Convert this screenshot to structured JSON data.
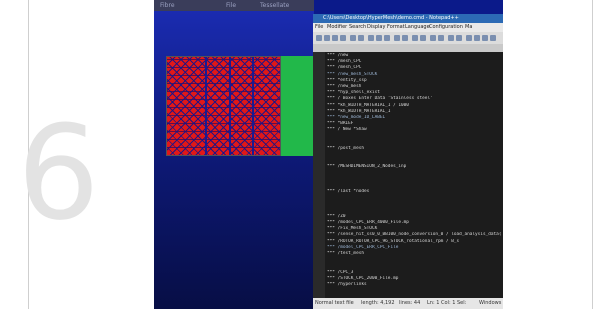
{
  "background_digit": "6",
  "viewer": {
    "menu": [
      "Fibre",
      "File",
      "Tessellate"
    ]
  },
  "editor": {
    "title": "C:\\Users\\Desktop\\HyperMesh\\demo.cmd - Notepad++",
    "menu": [
      "File",
      "Modifier",
      "Search",
      "Display",
      "Format",
      "Language",
      "Configuration",
      "Ma"
    ],
    "lines": [
      "*** /new",
      "*** /mesh_CPC",
      "*** /mesh_CPC",
      "*** /new_mesh_STOCK",
      "*** *entity_ssp",
      "*** /new_mesh",
      "*** *hyp_shell_exist",
      "*** / Boxes Enter Data 'Stainless steel'",
      "*** *kh_WIDTH_MATERIAL_1 / 1000",
      "*** *kh_WIDTH_MATERIAL_1",
      "*** *new_mode_ID_LABEL",
      "*** *BRIEF",
      "*** / New *Shaw",
      "",
      "",
      "*** /post_mesh",
      "",
      "",
      "*** /MESHDIMENSION_2_Nodes_inp",
      "",
      "",
      "",
      "*** /last *nodes",
      "",
      "",
      "",
      "*** /Z0",
      "*** /model_CPC_ERR_4000_File.mp",
      "*** /Fix_Mesh_STOCK",
      "*** /sense_hit_ss0_0_BB100_node_conversion_0 / load_analysis_data(0)",
      "*** /ROTOR_ROTOR_CPC_96_STOCK_rotational_rpm / B_s",
      "*** /model_CPC_ERR_CPC_File",
      "*** /test_mesh",
      "",
      "",
      "*** /CPC_3",
      "*** /STOCK_CPC_2000_File.mp",
      "*** /hyperlinks"
    ],
    "status": {
      "left": "Normal text file",
      "length": "length: 4,192",
      "lines": "lines: 44",
      "position": "Ln: 1   Col: 1   Sel:",
      "encoding": "Windows"
    }
  }
}
